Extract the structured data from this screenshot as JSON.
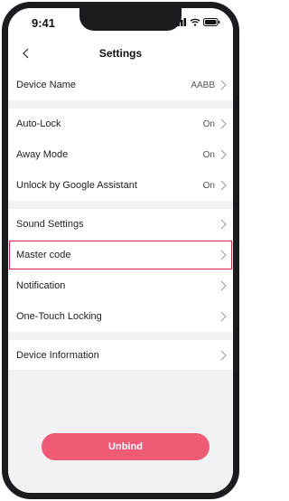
{
  "status": {
    "time": "9:41"
  },
  "nav": {
    "title": "Settings"
  },
  "groups": [
    [
      {
        "label": "Device Name",
        "value": "AABB"
      }
    ],
    [
      {
        "label": "Auto-Lock",
        "value": "On"
      },
      {
        "label": "Away Mode",
        "value": "On"
      },
      {
        "label": "Unlock by Google Assistant",
        "value": "On"
      }
    ],
    [
      {
        "label": "Sound Settings",
        "value": ""
      },
      {
        "label": "Master code",
        "value": ""
      },
      {
        "label": "Notification",
        "value": ""
      },
      {
        "label": "One-Touch Locking",
        "value": ""
      }
    ],
    [
      {
        "label": "Device Information",
        "value": ""
      }
    ]
  ],
  "highlighted_item": "Master code",
  "actions": {
    "unbind_label": "Unbind"
  },
  "colors": {
    "accent": "#ef5a74",
    "highlight": "#d7263d",
    "background": "#f2f2f4"
  },
  "icons": [
    "back-chevron-icon",
    "signal-icon",
    "wifi-icon",
    "battery-icon",
    "chevron-right-icon"
  ]
}
